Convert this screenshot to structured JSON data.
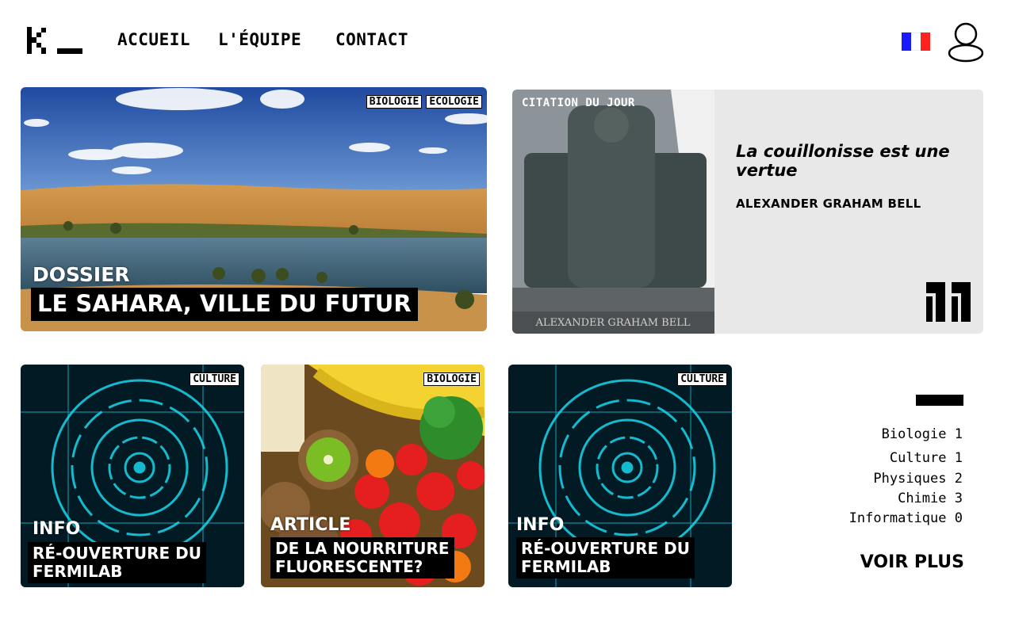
{
  "header": {
    "nav": [
      "ACCUEIL",
      "L'ÉQUIPE",
      "CONTACT"
    ],
    "flag_colors": [
      "#1a1aff",
      "#ffffff",
      "#ff2020"
    ]
  },
  "hero": {
    "tags": [
      "BIOLOGIE",
      "ECOLOGIE"
    ],
    "kind": "DOSSIER",
    "title": "LE SAHARA, VILLE DU FUTUR"
  },
  "quote": {
    "label": "CITATION DU JOUR",
    "text": "La couillonisse est une vertue",
    "author": "ALEXANDER GRAHAM BELL",
    "statue_inscription": "ALEXANDER GRAHAM BELL"
  },
  "cards": [
    {
      "tag": "CULTURE",
      "kind": "INFO",
      "title_lines": [
        "RÉ-OUVERTURE DU",
        "FERMILAB"
      ]
    },
    {
      "tag": "BIOLOGIE",
      "kind": "ARTICLE",
      "title_lines": [
        "DE LA NOURRITURE",
        "FLUORESCENTE?"
      ]
    },
    {
      "tag": "CULTURE",
      "kind": "INFO",
      "title_lines": [
        "RÉ-OUVERTURE DU",
        "FERMILAB"
      ]
    }
  ],
  "sidebar": {
    "categories": [
      {
        "name": "Biologie",
        "count": "1"
      },
      {
        "name": "Culture",
        "count": "1"
      },
      {
        "name": "Physiques",
        "count": "2"
      },
      {
        "name": "Chimie",
        "count": "3"
      },
      {
        "name": "Informatique",
        "count": "0"
      }
    ],
    "more": "VOIR PLUS"
  }
}
